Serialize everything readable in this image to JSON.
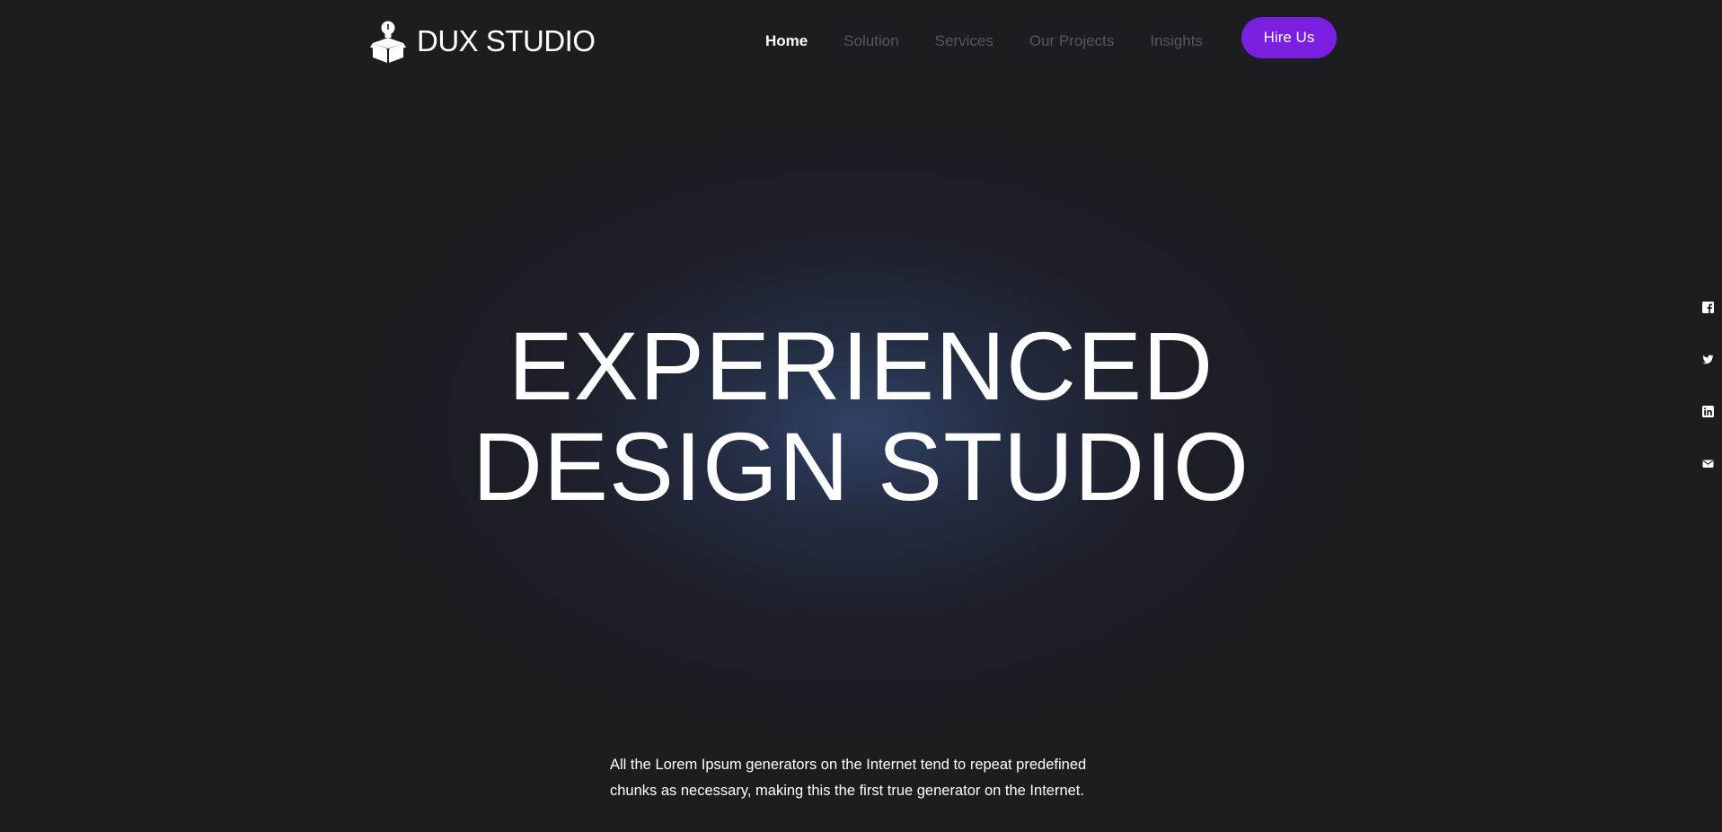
{
  "brand": {
    "name": "DUX STUDIO",
    "logo_icon": "lightbulb-box-icon"
  },
  "nav": {
    "items": [
      {
        "label": "Home",
        "active": true
      },
      {
        "label": "Solution",
        "active": false
      },
      {
        "label": "Services",
        "active": false
      },
      {
        "label": "Our Projects",
        "active": false
      },
      {
        "label": "Insights",
        "active": false
      }
    ],
    "cta_label": "Hire Us"
  },
  "hero": {
    "title_line1": "EXPERIENCED",
    "title_line2": "DESIGN STUDIO",
    "description": "All the Lorem Ipsum generators on the Internet tend to repeat predefined chunks as necessary, making this the first true generator on the Internet."
  },
  "socials": [
    {
      "icon": "facebook-icon"
    },
    {
      "icon": "twitter-icon"
    },
    {
      "icon": "linkedin-icon"
    },
    {
      "icon": "email-icon"
    }
  ],
  "colors": {
    "background": "#1c1c21",
    "accent": "#7a1fe0",
    "nav_inactive": "#55585f",
    "text": "#ffffff"
  }
}
